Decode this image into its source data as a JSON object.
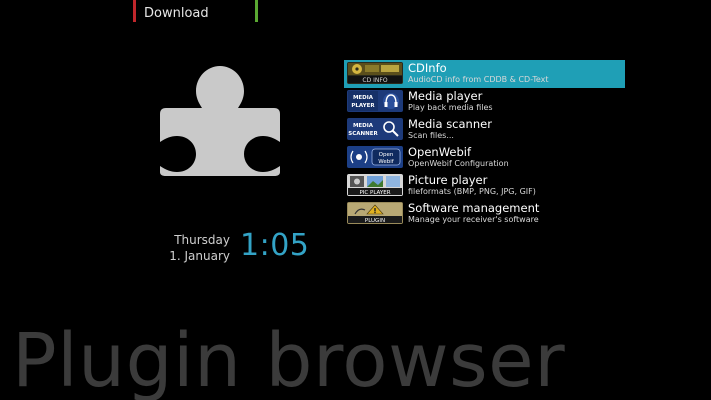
{
  "top_tabs": {
    "download_label": "Download",
    "red_color": "#c0262b",
    "green_color": "#5aa832"
  },
  "plugin_icon": "puzzle-piece-icon",
  "clock": {
    "weekday": "Thursday",
    "date": "1. January",
    "time": "1:05",
    "time_color": "#33a3c6"
  },
  "plugins": [
    {
      "name": "CDInfo",
      "description": "AudioCD info from CDDB & CD-Text",
      "icon": "cd-info-icon",
      "icon_text": "CD INFO",
      "selected": true
    },
    {
      "name": "Media player",
      "description": "Play back media files",
      "icon": "media-player-icon",
      "icon_text": "MEDIA PLAYER",
      "selected": false
    },
    {
      "name": "Media scanner",
      "description": "Scan files...",
      "icon": "media-scanner-icon",
      "icon_text": "MEDIA SCANNER",
      "selected": false
    },
    {
      "name": "OpenWebif",
      "description": "OpenWebif Configuration",
      "icon": "openwebif-icon",
      "icon_text": "Open Webif",
      "selected": false
    },
    {
      "name": "Picture player",
      "description": "fileformats (BMP, PNG, JPG, GIF)",
      "icon": "picture-player-icon",
      "icon_text": "PIC PLAYER",
      "selected": false
    },
    {
      "name": "Software management",
      "description": "Manage your receiver's software",
      "icon": "software-management-icon",
      "icon_text": "PLUGIN",
      "selected": false
    }
  ],
  "selection_color": "#1f9fb6",
  "page_title": "Plugin browser"
}
